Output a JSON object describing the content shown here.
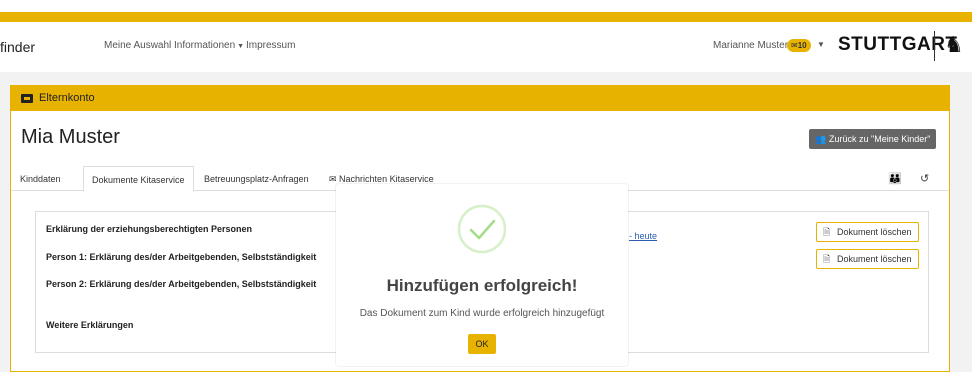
{
  "header": {
    "brand": "finder",
    "nav": [
      {
        "label": "Meine Auswahl"
      },
      {
        "label": "Informationen"
      },
      {
        "label": "Impressum"
      }
    ],
    "user_name": "Marianne Muster",
    "user_badge": "10",
    "logo_text": "STUTTGART"
  },
  "panel": {
    "heading": "Elternkonto",
    "child_name": "Mia Muster",
    "back_button": "Zurück zu \"Meine Kinder\"",
    "tabs": [
      {
        "label": "Kinddaten"
      },
      {
        "label": "Dokumente Kitaservice"
      },
      {
        "label": "Betreuungsplatz-Anfragen"
      },
      {
        "label": "Nachrichten Kitaservice"
      }
    ]
  },
  "documents": {
    "rows": [
      {
        "label": "Erklärung der erziehungsberechtigten Personen"
      },
      {
        "label": "Person 1: Erklärung des/der Arbeitgebenden, Selbstständigkeit"
      },
      {
        "label": "Person 2: Erklärung des/der Arbeitgebenden, Selbstständigkeit"
      },
      {
        "label": "Weitere Erklärungen"
      }
    ],
    "link_text": "- heute",
    "delete_label": "Dokument löschen"
  },
  "modal": {
    "title": "Hinzufügen erfolgreich!",
    "text": "Das Dokument zum Kind wurde erfolgreich hinzugefügt",
    "ok_label": "OK"
  },
  "colors": {
    "accent": "#e7b300",
    "success": "#a5dc86"
  }
}
